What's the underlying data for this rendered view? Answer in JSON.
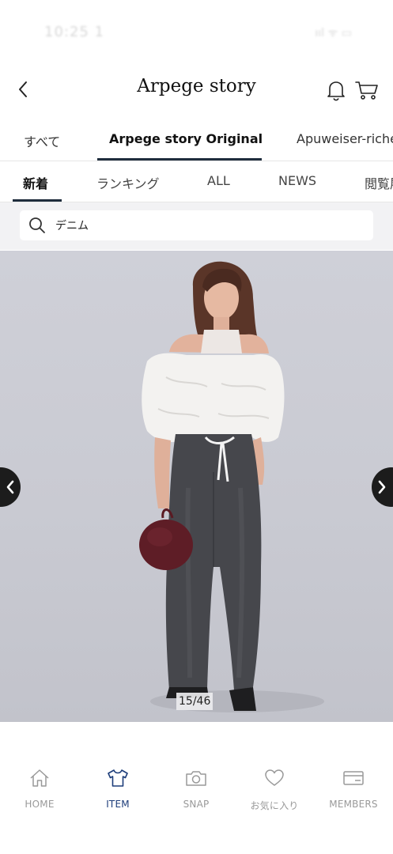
{
  "status_bar": {
    "time": "10:25 1",
    "icons": "ııl ᯤ ▭"
  },
  "header": {
    "title": "Arpege story",
    "icons": [
      "chevron-left-icon",
      "bell-icon",
      "cart-icon"
    ]
  },
  "brand_tabs": [
    {
      "label": "すべて",
      "active": false
    },
    {
      "label": "Arpege story Original",
      "active": true
    },
    {
      "label": "Apuweiser-riche",
      "active": false
    }
  ],
  "sub_tabs": [
    {
      "label": "新着",
      "active": true
    },
    {
      "label": "ランキング",
      "active": false
    },
    {
      "label": "ALL",
      "active": false
    },
    {
      "label": "NEWS",
      "active": false
    },
    {
      "label": "閲覧履歴",
      "active": false
    }
  ],
  "search": {
    "value": "デニム",
    "icon": "search-icon"
  },
  "carousel": {
    "counter": "15/46",
    "current": 15,
    "total": 46
  },
  "bottom_nav": [
    {
      "label": "HOME",
      "icon": "home-icon",
      "active": false
    },
    {
      "label": "ITEM",
      "icon": "tshirt-icon",
      "active": true
    },
    {
      "label": "SNAP",
      "icon": "camera-icon",
      "active": false
    },
    {
      "label": "お気に入り",
      "icon": "heart-icon",
      "active": false
    },
    {
      "label": "MEMBERS",
      "icon": "member-card-icon",
      "active": false
    }
  ],
  "colors": {
    "accent": "#1f2d3d",
    "active_nav": "#1d3d7a",
    "inactive_nav": "#999999",
    "image_bg": "#cfd0d8"
  }
}
